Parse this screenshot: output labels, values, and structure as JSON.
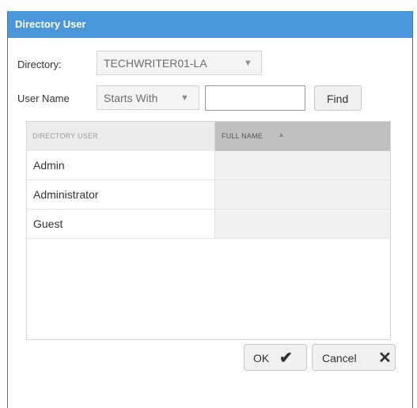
{
  "dialog": {
    "title": "Directory User"
  },
  "form": {
    "directory_label": "Directory:",
    "directory_value": "TECHWRITER01-LA",
    "username_label": "User Name",
    "match_mode": "Starts With",
    "username_value": "",
    "find_label": "Find"
  },
  "grid": {
    "columns": [
      "DIRECTORY USER",
      "FULL NAME"
    ],
    "sorted_column": "FULL NAME",
    "sort_direction": "ascending",
    "rows": [
      {
        "user": "Admin",
        "full_name": ""
      },
      {
        "user": "Administrator",
        "full_name": ""
      },
      {
        "user": "Guest",
        "full_name": ""
      }
    ]
  },
  "buttons": {
    "ok_label": "OK",
    "cancel_label": "Cancel"
  },
  "icons": {
    "dropdown": "chevron-down-icon",
    "sort": "sort-ascending-icon",
    "ok": "checkmark-icon",
    "cancel": "close-icon"
  },
  "colors": {
    "titlebar": "#4a98db",
    "sorted_header": "#c0c0c0"
  }
}
